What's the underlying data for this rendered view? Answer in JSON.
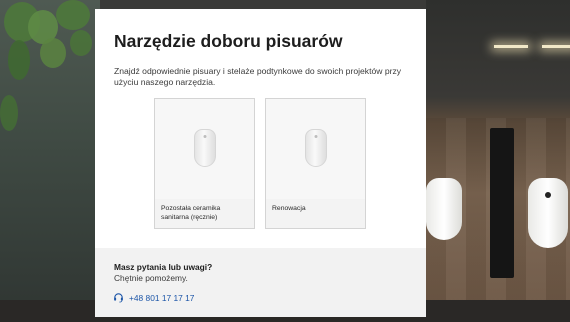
{
  "modal": {
    "title": "Narzędzie doboru pisuarów",
    "subtitle": "Znajdź odpowiednie pisuary i stelaże podtynkowe do swoich projektów przy użyciu naszego narzędzia."
  },
  "cards": [
    {
      "label": "Pozostała ceramika sanitarna (ręcznie)",
      "icon": "urinal-icon"
    },
    {
      "label": "Renowacja",
      "icon": "urinal-icon"
    }
  ],
  "footer": {
    "title": "Masz pytania lub uwagi?",
    "subtitle": "Chętnie pomożemy.",
    "phone": "+48 801 17 17 17",
    "phone_icon": "headset-icon",
    "link_color": "#1d56a8"
  }
}
